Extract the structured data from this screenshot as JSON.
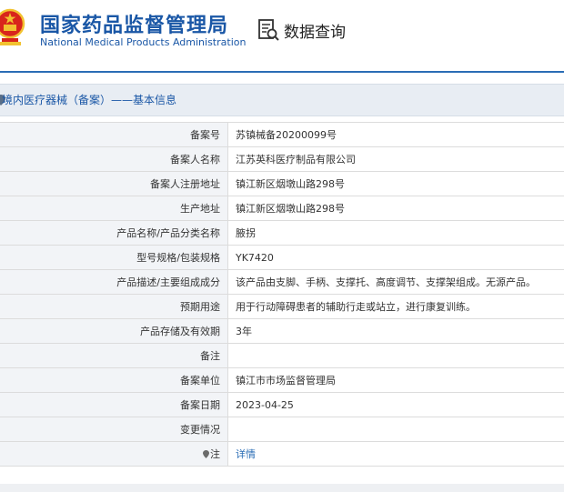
{
  "header": {
    "title_cn": "国家药品监督管理局",
    "title_en": "National Medical Products Administration",
    "search_label": "数据查询",
    "colors": {
      "brand": "#1a57a6",
      "emblem_red": "#d8261c",
      "emblem_gold": "#f2c230"
    }
  },
  "section": {
    "title": "境内医疗器械（备案）——基本信息"
  },
  "rows": [
    {
      "label": "备案号",
      "value": "苏镇械备20200099号"
    },
    {
      "label": "备案人名称",
      "value": "江苏英科医疗制品有限公司"
    },
    {
      "label": "备案人注册地址",
      "value": "镇江新区烟墩山路298号"
    },
    {
      "label": "生产地址",
      "value": "镇江新区烟墩山路298号"
    },
    {
      "label": "产品名称/产品分类名称",
      "value": "腋拐"
    },
    {
      "label": "型号规格/包装规格",
      "value": "YK7420"
    },
    {
      "label": "产品描述/主要组成成分",
      "value": "该产品由支脚、手柄、支撑托、高度调节、支撑架组成。无源产品。"
    },
    {
      "label": "预期用途",
      "value": "用于行动障碍患者的辅助行走或站立，进行康复训练。"
    },
    {
      "label": "产品存储及有效期",
      "value": "3年"
    },
    {
      "label": "备注",
      "value": ""
    },
    {
      "label": "备案单位",
      "value": "镇江市市场监督管理局"
    },
    {
      "label": "备案日期",
      "value": "2023-04-25"
    },
    {
      "label": "变更情况",
      "value": ""
    },
    {
      "label": "注",
      "value": "详情"
    }
  ]
}
